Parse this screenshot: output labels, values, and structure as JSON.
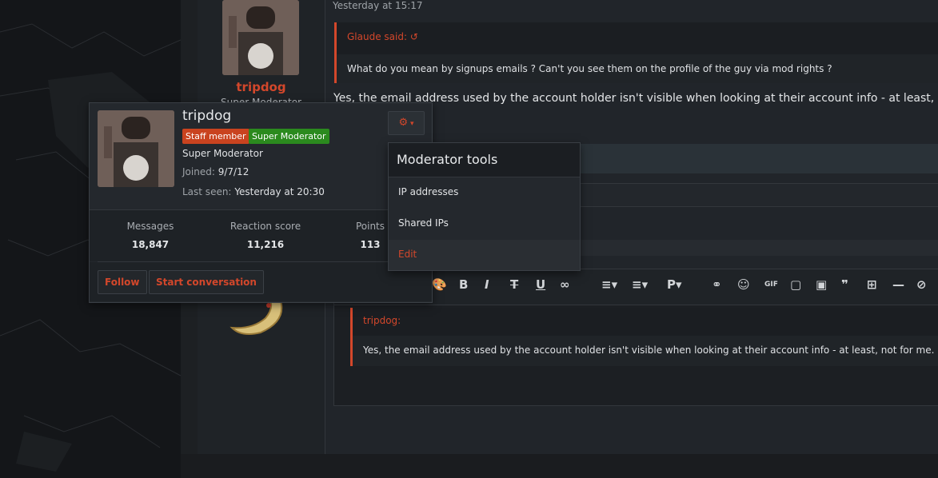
{
  "post": {
    "timestamp": "Yesterday at 15:17",
    "author_name": "tripdog",
    "author_title": "Super Moderator",
    "quote": {
      "attribution": "Glaude said:",
      "text": "What do you mean by signups emails ? Can't you see them on the profile of the guy via mod rights ?"
    },
    "body": "Yes, the email address used by the account holder isn't visible when looking at their account info - at least, not for me."
  },
  "editor": {
    "toolbar": [
      "palette-icon",
      "bold-icon",
      "italic-icon",
      "strikethrough-icon",
      "underline-icon",
      "more-icon",
      "list-icon",
      "align-icon",
      "paragraph-icon",
      "link-icon",
      "smiley-icon",
      "gif-icon",
      "attach-icon",
      "image-icon",
      "quote-icon",
      "table-icon",
      "hr-icon",
      "hide-icon"
    ],
    "quote": {
      "attribution": "tripdog:",
      "text": "Yes, the email address used by the account holder isn't visible when looking at their account info - at least, not for me."
    }
  },
  "member_card": {
    "name": "tripdog",
    "badges": [
      {
        "label": "Staff member",
        "color": "#c9431f"
      },
      {
        "label": "Super Moderator",
        "color": "#2b8a1e"
      }
    ],
    "title": "Super Moderator",
    "joined_label": "Joined:",
    "joined_value": "9/7/12",
    "last_seen_label": "Last seen:",
    "last_seen_value": "Yesterday at 20:30",
    "stats": [
      {
        "label": "Messages",
        "value": "18,847"
      },
      {
        "label": "Reaction score",
        "value": "11,216"
      },
      {
        "label": "Points",
        "value": "113"
      }
    ],
    "buttons": {
      "follow": "Follow",
      "start_conversation": "Start conversation"
    }
  },
  "moderator_menu": {
    "title": "Moderator tools",
    "items": [
      "IP addresses",
      "Shared IPs",
      "Edit"
    ]
  },
  "colors": {
    "accent": "#d3472b",
    "staff": "#c9431f",
    "moderator": "#2b8a1e"
  }
}
